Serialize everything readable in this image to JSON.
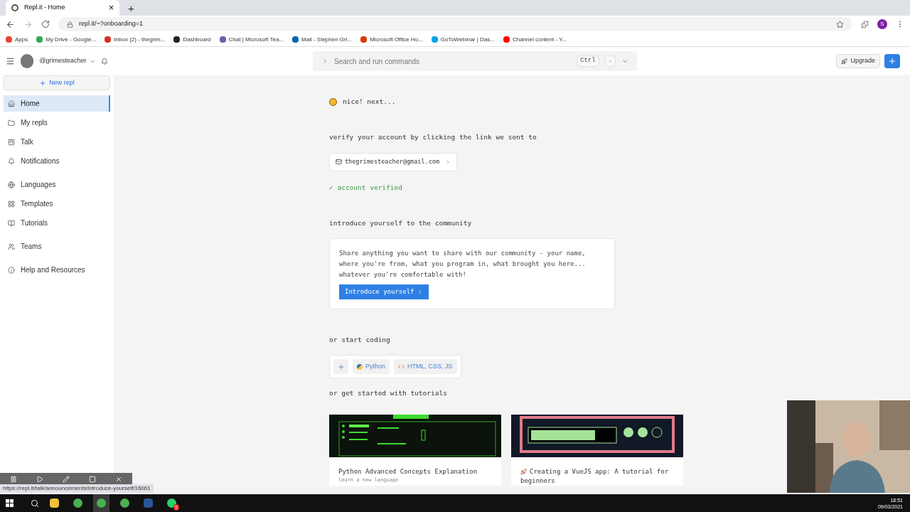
{
  "browser": {
    "tabs": [
      {
        "title": "Repl.it - Home",
        "selected": true,
        "close": "×"
      }
    ],
    "new_tab": "+",
    "address": "repl.it/~?onboarding=1",
    "avatar_letter": "S",
    "bookmarks": [
      {
        "label": "Apps",
        "kind": "apps"
      },
      {
        "label": "My Drive - Google...",
        "kind": "drive"
      },
      {
        "label": "Inbox (2) - thegrim...",
        "kind": "gmail"
      },
      {
        "label": "Dashboard",
        "kind": "dashboard"
      },
      {
        "label": "Chat | Microsoft Tea...",
        "kind": "teams"
      },
      {
        "label": "Mail - Stephen Gri...",
        "kind": "outlook"
      },
      {
        "label": "Microsoft Office Ho...",
        "kind": "office"
      },
      {
        "label": "GoToWebinar | Das...",
        "kind": "webinar"
      },
      {
        "label": "Channel content - Y...",
        "kind": "youtube"
      }
    ]
  },
  "header": {
    "username": "@grimesteacher",
    "search_placeholder": "Search and run commands",
    "keys": [
      "Ctrl",
      "."
    ],
    "upgrade": "Upgrade"
  },
  "sidebar": {
    "new_repl": "New repl",
    "groups": [
      [
        {
          "label": "Home",
          "kind": "home",
          "selected": true
        },
        {
          "label": "My repls",
          "kind": "folder",
          "selected": false
        },
        {
          "label": "Talk",
          "kind": "talk",
          "selected": false
        },
        {
          "label": "Notifications",
          "kind": "bell",
          "selected": false
        }
      ],
      [
        {
          "label": "Languages",
          "kind": "globe",
          "selected": false
        },
        {
          "label": "Templates",
          "kind": "grid",
          "selected": false
        },
        {
          "label": "Tutorials",
          "kind": "book",
          "selected": false
        }
      ],
      [
        {
          "label": "Teams",
          "kind": "users",
          "selected": false
        }
      ],
      [
        {
          "label": "Help and Resources",
          "kind": "info",
          "selected": false
        }
      ]
    ]
  },
  "onboarding": {
    "greeting": "nice! next...",
    "verify_prompt": "verify your account by clicking the link we sent to",
    "email": "thegrimesteacher@gmail.com",
    "verified": true,
    "verified_text": "✓ account verified",
    "introduce_heading": "introduce yourself to the community",
    "introduce_text": "Share anything you want to share with our community - your name, where you're from, what you program in, what brought you here... whatever you're comfortable with!",
    "introduce_button": "Introduce yourself",
    "coding_heading": "or start coding",
    "languages": [
      {
        "label": "Python",
        "kind": "python"
      },
      {
        "label": "HTML, CSS, JS",
        "kind": "html"
      }
    ],
    "tutorials_heading": "or get started with tutorials",
    "tutorials": [
      {
        "title": "Python Advanced Concepts Explanation",
        "subtitle": "learn a new language",
        "kind": "terminal"
      },
      {
        "title": "Creating a VueJS app: A tutorial for beginners",
        "kind": "game"
      }
    ]
  },
  "status_url": "https://repl.it/talk/announcements/introduce-yourself/16061",
  "taskbar": {
    "apps": [
      {
        "kind": "explorer",
        "selected": false
      },
      {
        "kind": "chrome",
        "selected": false
      },
      {
        "kind": "chrome",
        "selected": true
      },
      {
        "kind": "chrome",
        "selected": false
      },
      {
        "kind": "word",
        "selected": false
      },
      {
        "kind": "whatsapp",
        "badge": "5",
        "selected": false
      }
    ],
    "time": "18:51",
    "date": "09/03/2021"
  }
}
